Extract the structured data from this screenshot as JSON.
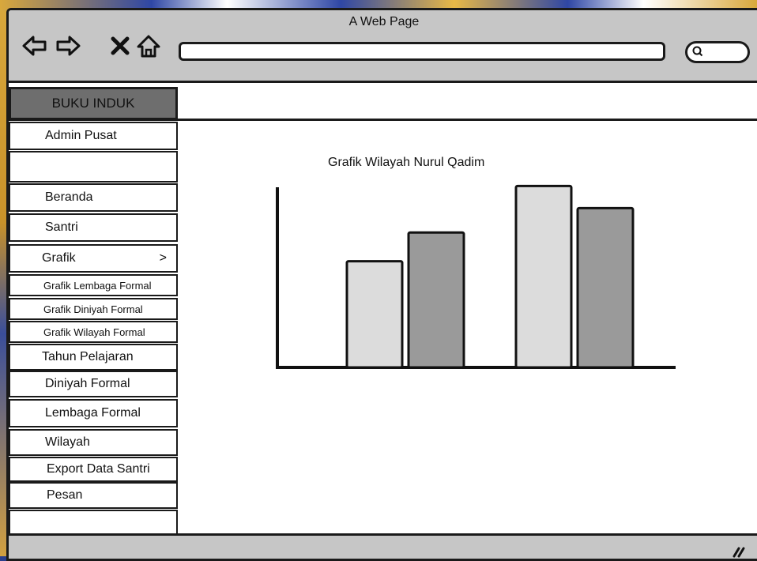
{
  "window": {
    "title": "A Web Page"
  },
  "sidebar": {
    "brand": "BUKU INDUK",
    "items": [
      {
        "label": "Admin Pusat"
      },
      {
        "label": ""
      },
      {
        "label": "Beranda"
      },
      {
        "label": "Santri"
      },
      {
        "label": "Grafik",
        "arrow": ">"
      },
      {
        "label": "Grafik Lembaga Formal"
      },
      {
        "label": "Grafik Diniyah Formal"
      },
      {
        "label": "Grafik Wilayah Formal"
      },
      {
        "label": "Tahun Pelajaran"
      },
      {
        "label": "Diniyah Formal"
      },
      {
        "label": "Lembaga Formal"
      },
      {
        "label": "Wilayah"
      },
      {
        "label": "Export Data Santri"
      },
      {
        "label": "Pesan"
      },
      {
        "label": ""
      }
    ]
  },
  "main": {
    "title": "Grafik Wilayah Nurul Qadim"
  },
  "chart_data": {
    "type": "bar",
    "title": "Grafik Wilayah Nurul Qadim",
    "categories": [
      "",
      ""
    ],
    "series": [
      {
        "values": [
          48,
          82
        ],
        "color": "#dcdcdc"
      },
      {
        "values": [
          61,
          72
        ],
        "color": "#9a9a9a"
      }
    ],
    "ylim": [
      0,
      100
    ],
    "grid": false
  }
}
